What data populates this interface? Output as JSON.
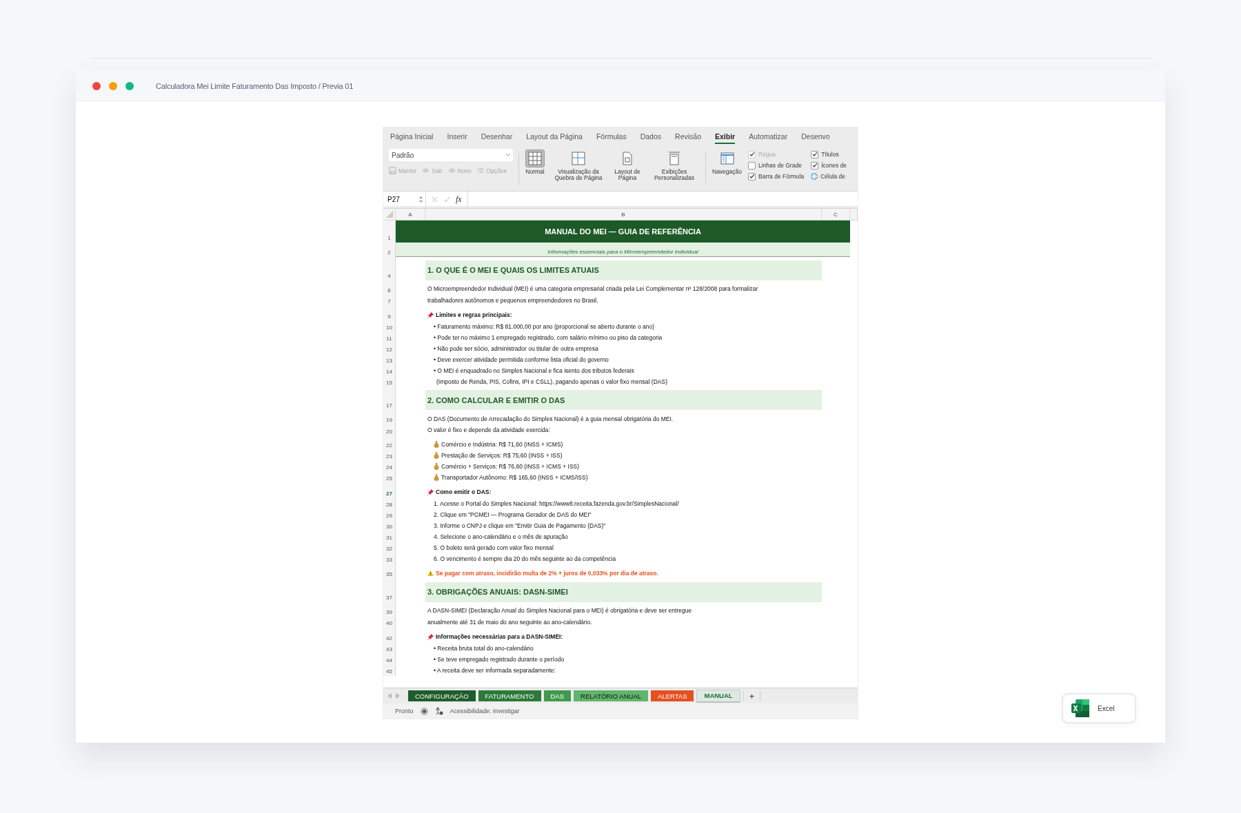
{
  "window": {
    "title": "Calculadora Mei Limite Faturamento Das Imposto",
    "separator": "/",
    "subtitle": "Previa 01"
  },
  "ribbon": {
    "tabs": [
      {
        "label": "Página Inicial",
        "selected": false
      },
      {
        "label": "Inserir",
        "selected": false
      },
      {
        "label": "Desenhar",
        "selected": false
      },
      {
        "label": "Layout da Página",
        "selected": false
      },
      {
        "label": "Fórmulas",
        "selected": false
      },
      {
        "label": "Dados",
        "selected": false
      },
      {
        "label": "Revisão",
        "selected": false
      },
      {
        "label": "Exibir",
        "selected": true
      },
      {
        "label": "Automatizar",
        "selected": false
      },
      {
        "label": "Desenvo",
        "selected": false
      }
    ],
    "view_select": {
      "value": "Padrão"
    },
    "view_actions": [
      {
        "label": "Manter",
        "disabled": true
      },
      {
        "label": "Sair",
        "disabled": true
      },
      {
        "label": "Novo",
        "disabled": true
      },
      {
        "label": "Opções",
        "disabled": true
      }
    ],
    "views": [
      {
        "label": "Normal",
        "selected": true
      },
      {
        "label": "Visualização da Quebra de Página",
        "selected": false
      },
      {
        "label": "Layout de Página",
        "selected": false
      },
      {
        "label": "Exibições Personalizadas",
        "selected": false
      },
      {
        "label": "Navegação",
        "selected": false
      }
    ],
    "options": [
      {
        "kind": "checkbox",
        "label": "Régua",
        "checked": true,
        "disabled": true
      },
      {
        "kind": "checkbox",
        "label": "Linhas de Grade",
        "checked": false,
        "disabled": false
      },
      {
        "kind": "checkbox",
        "label": "Barra de Fórmula",
        "checked": true,
        "disabled": false
      },
      {
        "kind": "checkbox",
        "label": "Títulos",
        "checked": true,
        "disabled": false
      },
      {
        "kind": "checkbox",
        "label": "Ícones de",
        "checked": true,
        "disabled": false
      },
      {
        "kind": "cell-toggle",
        "label": "Célula de"
      }
    ]
  },
  "formula_bar": {
    "name_box": "P27",
    "function_label": "fx"
  },
  "columns": [
    "A",
    "B",
    "C"
  ],
  "rows": [
    {
      "kind": "title",
      "number": "1",
      "text": "MANUAL DO MEI — GUIA DE REFERÊNCIA"
    },
    {
      "kind": "subtitle",
      "number": "2",
      "text": "Informações essenciais para o Microempreendedor Individual"
    },
    {
      "kind": "spacer"
    },
    {
      "kind": "section",
      "number": "4",
      "text": "1. O QUE É O MEI E QUAIS OS LIMITES ATUAIS"
    },
    {
      "kind": "spacer"
    },
    {
      "kind": "text",
      "number": "6",
      "text": "O Microempreendedor Individual (MEI) é uma categoria empresarial criada pela Lei Complementar nº 128/2008 para formalizar"
    },
    {
      "kind": "text",
      "number": "7",
      "text": "trabalhadores autônomos e pequenos empreendedores no Brasil."
    },
    {
      "kind": "spacer"
    },
    {
      "kind": "heading",
      "number": "9",
      "text": "Limites e regras principais:"
    },
    {
      "kind": "bullet",
      "number": "10",
      "text": "• Faturamento máximo: R$ 81.000,00 por ano (proporcional se aberto durante o ano)"
    },
    {
      "kind": "bullet",
      "number": "11",
      "text": "• Pode ter no máximo 1 empregado registrado, com salário mínimo ou piso da categoria"
    },
    {
      "kind": "bullet",
      "number": "12",
      "text": "• Não pode ser sócio, administrador ou titular de outra empresa"
    },
    {
      "kind": "bullet",
      "number": "13",
      "text": "• Deve exercer atividade permitida conforme lista oficial do governo"
    },
    {
      "kind": "bullet",
      "number": "14",
      "text": "• O MEI é enquadrado no Simples Nacional e fica isento dos tributos federais"
    },
    {
      "kind": "continuation",
      "number": "15",
      "text": "(Imposto de Renda, PIS, Cofins, IPI e CSLL), pagando apenas o valor fixo mensal (DAS)"
    },
    {
      "kind": "spacer"
    },
    {
      "kind": "section",
      "number": "17",
      "text": "2. COMO CALCULAR E EMITIR O DAS"
    },
    {
      "kind": "spacer"
    },
    {
      "kind": "text",
      "number": "19",
      "text": "O DAS (Documento de Arrecadação do Simples Nacional) é a guia mensal obrigatória do MEI."
    },
    {
      "kind": "text",
      "number": "20",
      "text": "O valor é fixo e depende da atividade exercida:"
    },
    {
      "kind": "spacer"
    },
    {
      "kind": "money",
      "number": "22",
      "text": "Comércio e Indústria: R$ 71,60 (INSS + ICMS)"
    },
    {
      "kind": "money",
      "number": "23",
      "text": "Prestação de Serviços: R$ 75,60 (INSS + ISS)"
    },
    {
      "kind": "money",
      "number": "24",
      "text": "Comércio + Serviços: R$ 76,60 (INSS + ICMS + ISS)"
    },
    {
      "kind": "money",
      "number": "25",
      "text": "Transportador Autônomo: R$ 165,60 (INSS + ICMS/ISS)"
    },
    {
      "kind": "spacer"
    },
    {
      "kind": "heading",
      "number": "27",
      "text": "Como emitir o DAS:",
      "active": true
    },
    {
      "kind": "bullet",
      "number": "28",
      "text": "1. Acesse o Portal do Simples Nacional: https://www8.receita.fazenda.gov.br/SimplesNacional/"
    },
    {
      "kind": "bullet",
      "number": "29",
      "text": "2. Clique em \"PGMEI — Programa Gerador de DAS do MEI\""
    },
    {
      "kind": "bullet",
      "number": "30",
      "text": "3. Informe o CNPJ e clique em \"Emitir Guia de Pagamento (DAS)\""
    },
    {
      "kind": "bullet",
      "number": "31",
      "text": "4. Selecione o ano-calendário e o mês de apuração"
    },
    {
      "kind": "bullet",
      "number": "32",
      "text": "5. O boleto será gerado com valor fixo mensal"
    },
    {
      "kind": "bullet",
      "number": "33",
      "text": "6. O vencimento é sempre dia 20 do mês seguinte ao da competência"
    },
    {
      "kind": "spacer"
    },
    {
      "kind": "warning",
      "number": "35",
      "text": "Se pagar com atraso, incidirão multa de 2% + juros de 0,033% por dia de atraso."
    },
    {
      "kind": "spacer"
    },
    {
      "kind": "section",
      "number": "37",
      "text": "3. OBRIGAÇÕES ANUAIS: DASN-SIMEI"
    },
    {
      "kind": "spacer"
    },
    {
      "kind": "text",
      "number": "39",
      "text": "A DASN-SIMEI (Declaração Anual do Simples Nacional para o MEI) é obrigatória e deve ser entregue"
    },
    {
      "kind": "text",
      "number": "40",
      "text": "anualmente até 31 de maio do ano seguinte ao ano-calendário."
    },
    {
      "kind": "spacer"
    },
    {
      "kind": "heading",
      "number": "42",
      "text": "Informações necessárias para a DASN-SIMEI:"
    },
    {
      "kind": "bullet",
      "number": "43",
      "text": "• Receita bruta total do ano-calendário"
    },
    {
      "kind": "bullet",
      "number": "44",
      "text": "• Se teve empregado registrado durante o período"
    },
    {
      "kind": "bullet",
      "number": "45",
      "text": "• A receita deve ser informada separadamente:"
    }
  ],
  "sheet_tabs": [
    {
      "label": "CONFIGURAÇÃO",
      "color": "#1e5c2b",
      "selected": false
    },
    {
      "label": "FATURAMENTO",
      "color": "#2c7a38",
      "selected": false
    },
    {
      "label": "DAS",
      "color": "#3f9a4c",
      "selected": false
    },
    {
      "label": "RELATÓRIO ANUAL",
      "color": "#5fb56c",
      "selected": false
    },
    {
      "label": "ALERTAS",
      "color": "#e4501f",
      "selected": false
    },
    {
      "label": "MANUAL",
      "color": "#dfe8e2",
      "selected": true
    }
  ],
  "add_sheet": "+",
  "status": {
    "ready": "Pronto",
    "accessibility": "Acessibilidade: investigar"
  },
  "app_badge": {
    "label": "Excel"
  }
}
